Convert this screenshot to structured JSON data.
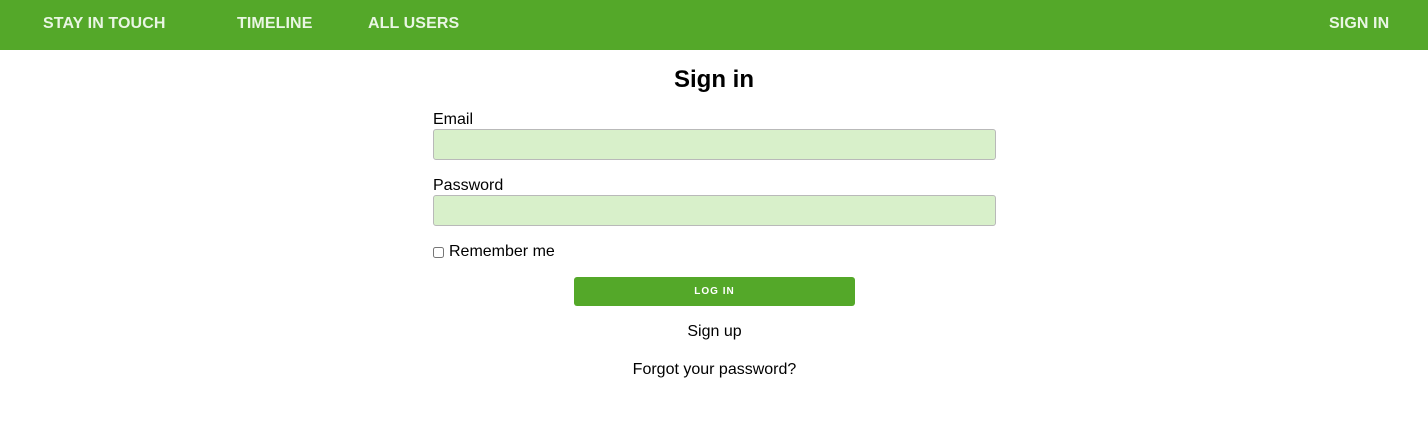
{
  "navbar": {
    "brand": "STAY IN TOUCH",
    "links": [
      {
        "label": "TIMELINE"
      },
      {
        "label": "ALL USERS"
      }
    ],
    "signin": "SIGN IN"
  },
  "page": {
    "title": "Sign in"
  },
  "form": {
    "email": {
      "label": "Email",
      "value": "",
      "placeholder": ""
    },
    "password": {
      "label": "Password",
      "value": "",
      "placeholder": ""
    },
    "remember": {
      "label": "Remember me",
      "checked": false
    },
    "submit_label": "LOG IN",
    "signup_link": "Sign up",
    "forgot_link": "Forgot your password?"
  },
  "colors": {
    "brand_green": "#54a829",
    "nav_text": "#e9f6e3",
    "input_background": "#d8f0ca"
  }
}
